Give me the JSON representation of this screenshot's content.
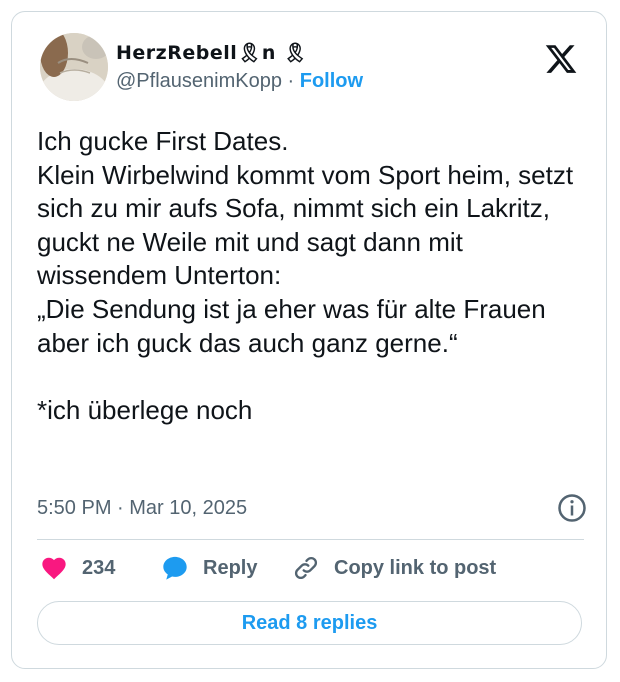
{
  "author": {
    "display_name": "HerzRebell🎗n 🎗",
    "handle": "@PflausenimKopp",
    "separator": "·",
    "follow_label": "Follow"
  },
  "tweet": {
    "text": "Ich gucke First Dates.\nKlein Wirbelwind kommt vom Sport heim, setzt sich zu mir aufs Sofa, nimmt sich ein Lakritz, guckt ne Weile mit und sagt dann mit wissendem Unterton:\n„Die Sendung ist ja eher was für alte Frauen aber ich guck das auch ganz gerne.“\n\n*ich überlege noch",
    "timestamp": "5:50 PM · Mar 10, 2025"
  },
  "actions": {
    "like_count": "234",
    "reply_label": "Reply",
    "copy_label": "Copy link to post"
  },
  "footer": {
    "read_replies_label": "Read 8 replies"
  },
  "colors": {
    "accent": "#1d9bf0",
    "like": "#f91880",
    "muted": "#536471",
    "border": "#cfd9de",
    "text": "#0f1419"
  },
  "icons": [
    "avatar-photo",
    "x-logo-icon",
    "info-icon",
    "heart-icon",
    "reply-bubble-icon",
    "link-icon"
  ]
}
